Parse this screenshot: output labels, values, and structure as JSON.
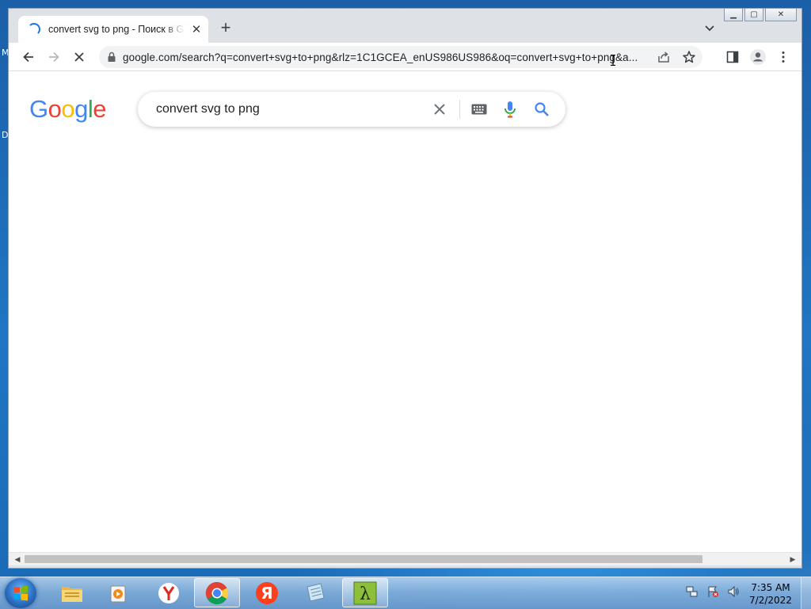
{
  "desktop": {
    "edge_texts": [
      "M",
      "D"
    ]
  },
  "browser": {
    "tab": {
      "title": "convert svg to png - Поиск в Google",
      "close_glyph": "✕"
    },
    "new_tab_glyph": "+",
    "window_controls": {
      "minimize_glyph": "▁",
      "maximize_glyph": "▢",
      "close_glyph": "✕"
    },
    "address_bar": {
      "url": "google.com/search?q=convert+svg+to+png&rlz=1C1GCEA_enUS986US986&oq=convert+svg+to+png&a..."
    }
  },
  "page": {
    "logo_letters": [
      "G",
      "o",
      "o",
      "g",
      "l",
      "e"
    ],
    "logo_colors": [
      "#4285F4",
      "#EA4335",
      "#FBBC05",
      "#4285F4",
      "#34A853",
      "#EA4335"
    ],
    "search": {
      "query": "convert svg to png"
    }
  },
  "taskbar": {
    "apps": [
      {
        "name": "explorer",
        "icon": "folder-icon"
      },
      {
        "name": "media-player",
        "icon": "media-player-icon"
      },
      {
        "name": "yandex-browser",
        "icon": "yandex-browser-icon"
      },
      {
        "name": "chrome",
        "icon": "chrome-icon",
        "active": true
      },
      {
        "name": "yandex",
        "icon": "yandex-icon"
      },
      {
        "name": "notepad",
        "icon": "notepad-icon"
      },
      {
        "name": "lambda-app",
        "icon": "lambda-icon"
      }
    ],
    "clock": {
      "time": "7:35 AM",
      "date": "7/2/2022"
    }
  }
}
